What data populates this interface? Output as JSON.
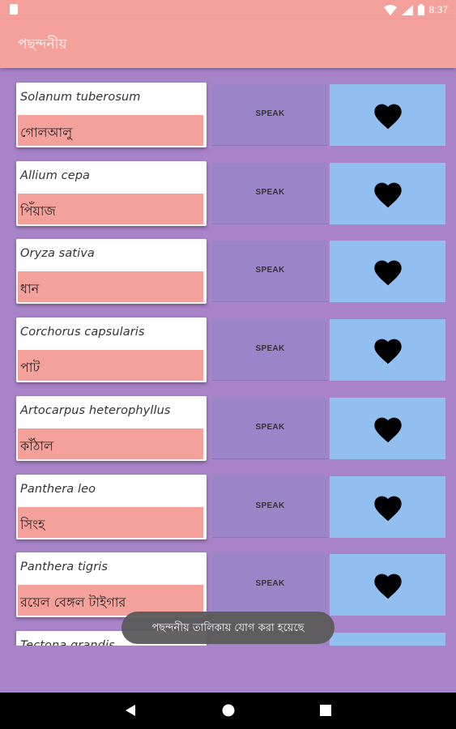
{
  "status_bar": {
    "time": "8:37",
    "icons": [
      "sim-card-icon",
      "wifi-icon",
      "signal-icon",
      "battery-icon"
    ]
  },
  "app_bar": {
    "title": "পছন্দনীয়"
  },
  "list": {
    "speak_label": "SPEAK",
    "items": [
      {
        "scientific": "Solanum tuberosum",
        "common": "গোলআলু"
      },
      {
        "scientific": "Allium cepa",
        "common": "পিঁয়াজ"
      },
      {
        "scientific": "Oryza sativa",
        "common": "ধান"
      },
      {
        "scientific": "Corchorus capsularis",
        "common": "পাট"
      },
      {
        "scientific": "Artocarpus heterophyllus",
        "common": "কাঁঠাল"
      },
      {
        "scientific": "Panthera leo",
        "common": "সিংহ"
      },
      {
        "scientific": "Panthera tigris",
        "common": "রয়েল বেঙ্গল টাইগার"
      },
      {
        "scientific": "Tectona grandis",
        "common": ""
      }
    ]
  },
  "toast": {
    "message": "পছন্দনীয় তালিকায় যোগ করা হয়েছে"
  },
  "colors": {
    "accent": "#f4a19c",
    "background": "#a883c8",
    "speak_bg": "#9b85c9",
    "fav_bg": "#90bff0"
  },
  "nav_bar": {
    "icons": [
      "back-icon",
      "home-icon",
      "recents-icon"
    ]
  }
}
